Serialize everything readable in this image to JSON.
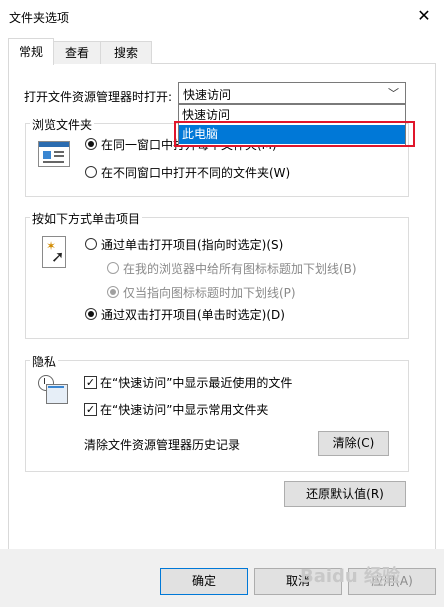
{
  "window": {
    "title": "文件夹选项",
    "close_glyph": "✕"
  },
  "tabs": [
    "常规",
    "查看",
    "搜索"
  ],
  "open_explorer": {
    "label": "打开文件资源管理器时打开:",
    "value": "快速访问",
    "options": [
      "快速访问",
      "此电脑"
    ]
  },
  "browse": {
    "legend": "浏览文件夹",
    "same_window": "在同一窗口中打开每个文件夹(M)",
    "new_window": "在不同窗口中打开不同的文件夹(W)"
  },
  "click": {
    "legend": "按如下方式单击项目",
    "single": "通过单击打开项目(指向时选定)(S)",
    "underline_all": "在我的浏览器中给所有图标标题加下划线(B)",
    "underline_point": "仅当指向图标标题时加下划线(P)",
    "double": "通过双击打开项目(单击时选定)(D)"
  },
  "privacy": {
    "legend": "隐私",
    "recent_files": "在“快速访问”中显示最近使用的文件",
    "frequent_folders": "在“快速访问”中显示常用文件夹",
    "clear_label": "清除文件资源管理器历史记录",
    "clear_button": "清除(C)"
  },
  "restore_button": "还原默认值(R)",
  "footer": {
    "ok": "确定",
    "cancel": "取消",
    "apply": "应用(A)"
  },
  "watermark": "Baidu 经验"
}
